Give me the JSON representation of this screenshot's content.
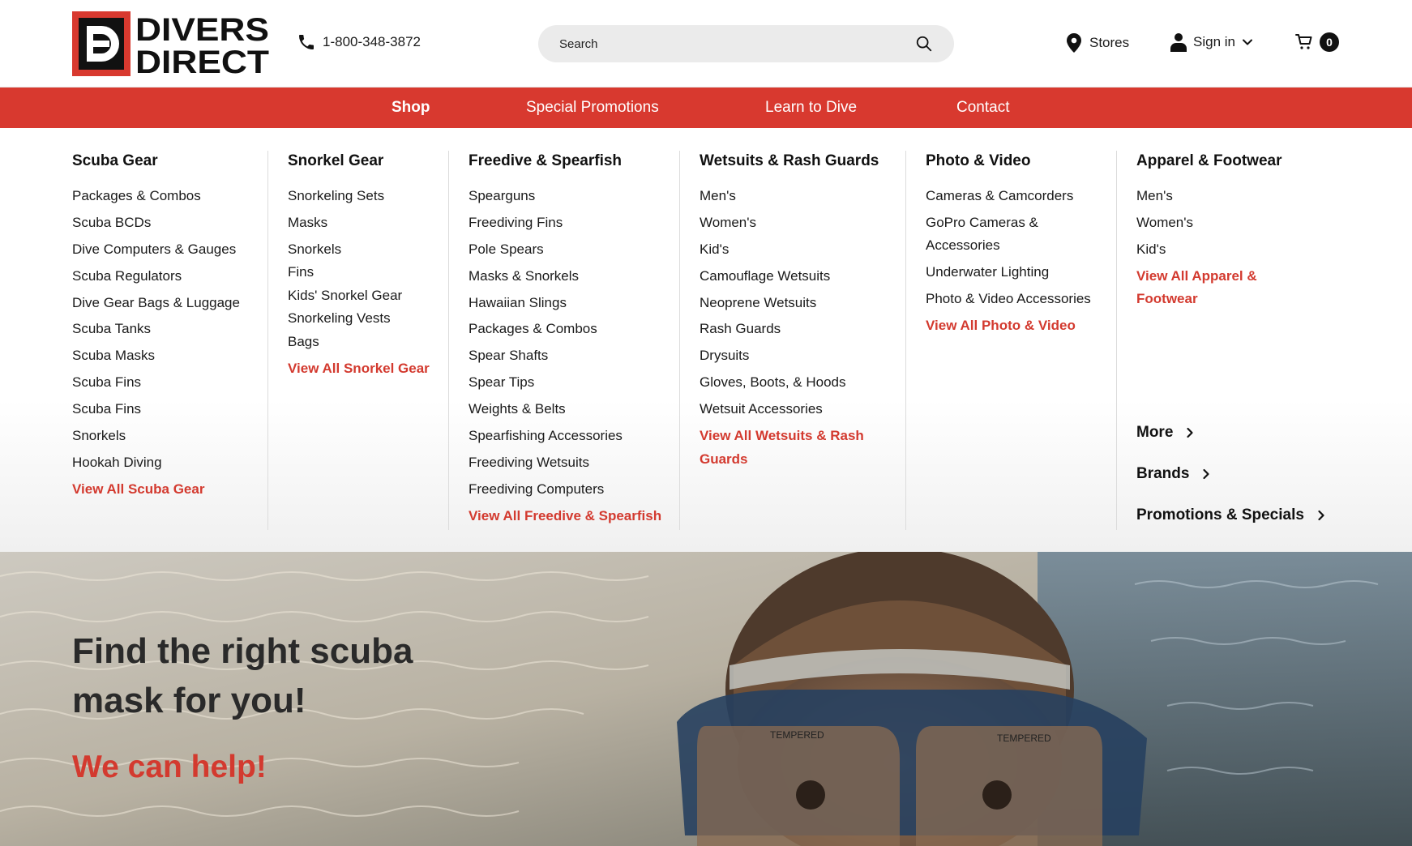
{
  "brand": {
    "logo_line1": "DIVERS",
    "logo_line2": "DIRECT",
    "accent_color": "#d8392f"
  },
  "header": {
    "phone": "1-800-348-3872",
    "search_placeholder": "Search",
    "stores_label": "Stores",
    "signin_label": "Sign in",
    "cart_count": "0"
  },
  "nav": {
    "items": [
      {
        "label": "Shop",
        "active": true
      },
      {
        "label": "Special Promotions"
      },
      {
        "label": "Learn to Dive"
      },
      {
        "label": "Contact"
      }
    ]
  },
  "mega_menu": {
    "columns": [
      {
        "title": "Scuba Gear",
        "items": [
          "Packages & Combos",
          "Scuba BCDs",
          "Dive Computers & Gauges",
          "Scuba Regulators",
          "Dive Gear Bags & Luggage",
          "Scuba Tanks",
          "Scuba Masks",
          "Scuba Fins",
          "Scuba Fins",
          "Snorkels",
          "Hookah Diving"
        ],
        "view_all": "View All Scuba Gear"
      },
      {
        "title": "Snorkel Gear",
        "items": [
          "Snorkeling Sets",
          "Masks",
          "Snorkels",
          "Fins",
          "Kids' Snorkel Gear",
          "Snorkeling Vests",
          "Bags"
        ],
        "view_all": "View All Snorkel Gear"
      },
      {
        "title": "Freedive & Spearfish",
        "items": [
          "Spearguns",
          "Freediving Fins",
          "Pole Spears",
          "Masks & Snorkels",
          "Hawaiian Slings",
          "Packages & Combos",
          "Spear Shafts",
          "Spear Tips",
          "Weights & Belts",
          "Spearfishing Accessories",
          "Freediving Wetsuits",
          "Freediving Computers"
        ],
        "view_all": "View All Freedive & Spearfish"
      },
      {
        "title": "Wetsuits & Rash Guards",
        "items": [
          "Men's",
          "Women's",
          "Kid's",
          "Camouflage Wetsuits",
          "Neoprene Wetsuits",
          "Rash Guards",
          "Drysuits",
          "Gloves, Boots, & Hoods",
          "Wetsuit Accessories"
        ],
        "view_all": "View All Wetsuits & Rash Guards"
      },
      {
        "title": "Photo & Video",
        "items": [
          "Cameras & Camcorders",
          "GoPro Cameras & Accessories",
          "Underwater Lighting",
          "Photo & Video Accessories"
        ],
        "view_all": "View All Photo & Video"
      },
      {
        "title": "Apparel & Footwear",
        "items": [
          "Men's",
          "Women's",
          "Kid's"
        ],
        "view_all": "View All Apparel & Footwear"
      }
    ],
    "extra_links": [
      "More",
      "Brands",
      "Promotions & Specials"
    ]
  },
  "hero": {
    "title": "Find the right scuba mask for you!",
    "subtitle": "We can help!",
    "mask_text_left": "TEMPERED",
    "mask_text_right": "TEMPERED"
  }
}
